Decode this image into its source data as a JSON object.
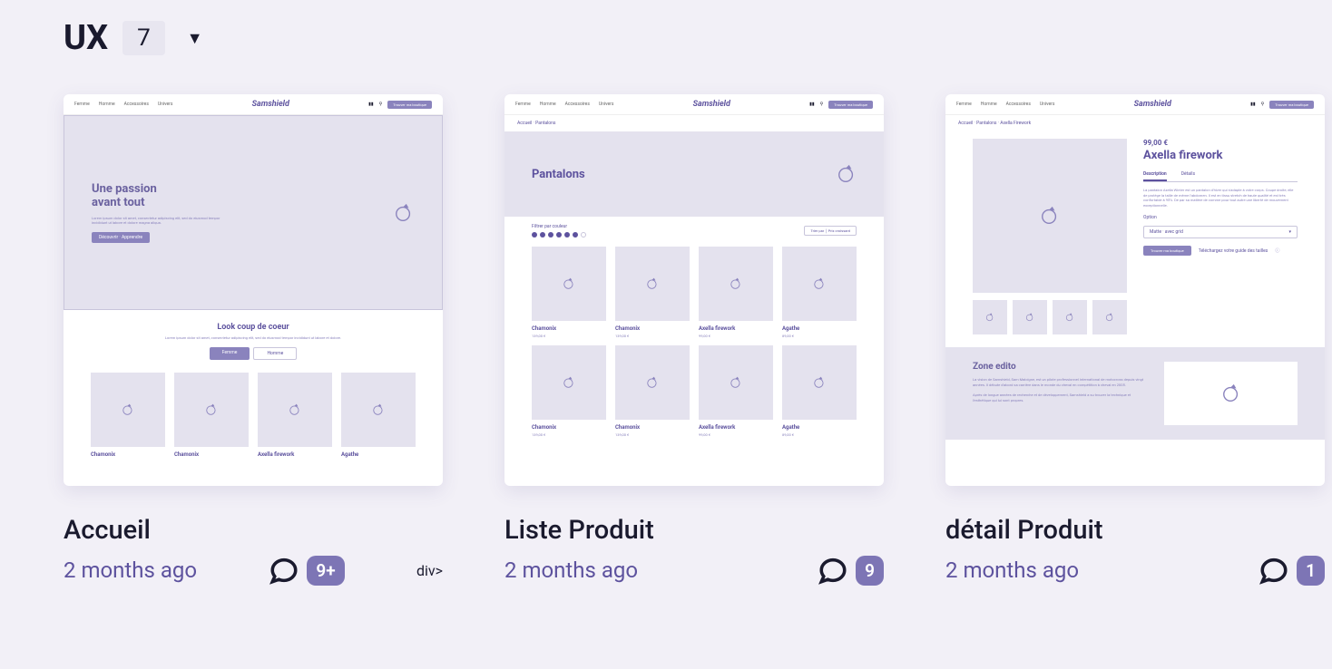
{
  "section": {
    "title": "UX",
    "count": "7"
  },
  "cards": [
    {
      "title": "Accueil",
      "time": "2 months ago",
      "comments": "9+",
      "mock": {
        "nav": [
          "Femme",
          "Homme",
          "Accessoires",
          "Univers"
        ],
        "logo": "Samshield",
        "header_btn": "Trouver ma boutique",
        "hero_title_l1": "Une passion",
        "hero_title_l2": "avant tout",
        "hero_desc": "Lorem ipsum dolor sit amet, consectetur adipiscing elit, sed do eiusmod tempor incididunt ut labore et dolore magna aliqua.",
        "hero_btn": "Découvrir · Apprendre",
        "section_title": "Look coup de coeur",
        "section_desc": "Lorem ipsum dolor sit amet, consectetur adipiscing elit, sed do eiusmod tempor incididunt ut labore et dolore.",
        "toggle_a": "Femme",
        "toggle_b": "Homme",
        "products": [
          {
            "name": "Chamonix",
            "price": ""
          },
          {
            "name": "Chamonix",
            "price": ""
          },
          {
            "name": "Axella firework",
            "price": ""
          },
          {
            "name": "Agathe",
            "price": ""
          }
        ]
      }
    },
    {
      "title": "Liste Produit",
      "time": "2 months ago",
      "comments": "9",
      "mock": {
        "nav": [
          "Femme",
          "Homme",
          "Accessoires",
          "Univers"
        ],
        "logo": "Samshield",
        "header_btn": "Trouver ma boutique",
        "breadcrumb": "Accueil · Pantalons",
        "cat_title": "Pantalons",
        "filter_label": "Filtrer par couleur",
        "sort_label": "Trier par",
        "sort_value": "Prix croissant",
        "products_row1": [
          {
            "name": "Chamonix",
            "price": "139,00 €"
          },
          {
            "name": "Chamonix",
            "price": "139,00 €"
          },
          {
            "name": "Axella firework",
            "price": "99,00 €"
          },
          {
            "name": "Agathe",
            "price": "89,00 €"
          }
        ],
        "products_row2": [
          {
            "name": "Chamonix",
            "price": "139,00 €"
          },
          {
            "name": "Chamonix",
            "price": "139,00 €"
          },
          {
            "name": "Axella firework",
            "price": "99,00 €"
          },
          {
            "name": "Agathe",
            "price": "89,00 €"
          }
        ]
      }
    },
    {
      "title": "détail Produit",
      "time": "2 months ago",
      "comments": "1",
      "mock": {
        "nav": [
          "Femme",
          "Homme",
          "Accessoires",
          "Univers"
        ],
        "logo": "Samshield",
        "header_btn": "Trouver ma boutique",
        "breadcrumb": "Accueil · Pantalons · Axella Firework",
        "price": "99,00 €",
        "product_title": "Axella firework",
        "tab_a": "Description",
        "tab_b": "Détails",
        "longtext": "La pantalon Axella Winter est un pantalon d'hiver qui s'adapte à votre corps. Coupe droite, elle de protège la taille de même l'abdomen. Il est en tissu stretch de haute qualité et est très confortable à 95%. De par sa matière de comme pour tout autre une liberté de mouvement exceptionnelle.",
        "option_label": "Option",
        "option_value": "Matte · avec grid",
        "cta": "Trouver ma boutique",
        "guide": "Téléchargez votre guide des tailles",
        "edito_title": "Zone edito",
        "edito_text": "La vision de Samshield, Sam Maloigne, est un pilote professionnel international de motocross depuis vingt années. Il débute d'abord sa carrière dans le monde du cheval en compétition à cheval en 2005.",
        "edito_text2": "Après de longue années de recherche et de développement, Samshield a su trouver la technique et l'esthétique qui lui sont propres."
      }
    }
  ]
}
